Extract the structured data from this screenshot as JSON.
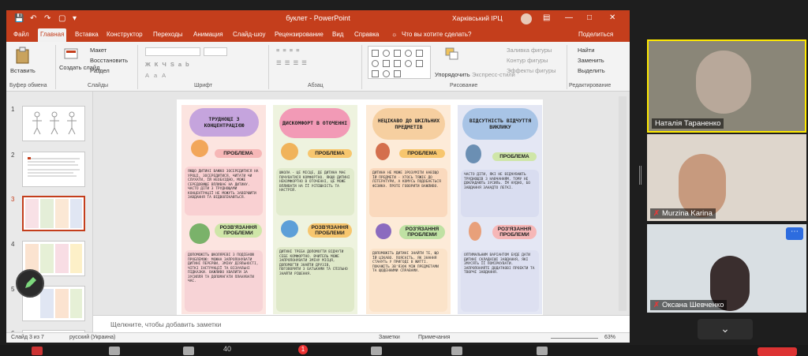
{
  "powerpoint": {
    "document_title": "буклет - PowerPoint",
    "org_label": "Харківський ІРЦ",
    "tabs": [
      "Файл",
      "Главная",
      "Вставка",
      "Конструктор",
      "Переходы",
      "Анимация",
      "Слайд-шоу",
      "Рецензирование",
      "Вид",
      "Справка"
    ],
    "active_tab": "Главная",
    "tell_me": "Что вы хотите сделать?",
    "share": "Поделиться",
    "ribbon": {
      "paste": "Вставить",
      "clipboard": "Буфер обмена",
      "layout": "Макет",
      "restore": "Восстановить",
      "section": "Раздел",
      "new_slide": "Создать слайд",
      "slides": "Слайды",
      "font": "Шрифт",
      "paragraph": "Абзац",
      "arrange": "Упорядочить",
      "quick_styles": "Экспресс-стили",
      "shape_fill": "Заливка фигуры",
      "shape_outline": "Контур фигуры",
      "shape_effects": "Эффекты фигуры",
      "drawing": "Рисование",
      "find": "Найти",
      "replace": "Заменить",
      "select": "Выделить",
      "editing": "Редактирование"
    },
    "slide_numbers": [
      "1",
      "2",
      "3",
      "4",
      "5",
      "6"
    ],
    "notes_placeholder": "Щелкните, чтобы добавить заметки",
    "status": {
      "slide": "Слайд 3 из 7",
      "language": "русский (Украина)",
      "notes": "Заметки",
      "comments": "Примечания",
      "zoom": "63%"
    },
    "slide": {
      "panels": [
        {
          "title": "ТРУДНОЩІ З КОНЦЕНТРАЦІЄЮ",
          "problem": "ПРОБЛЕМА",
          "problem_text": "ЯКЩО ДИТИНІ ВАЖКО ЗОСЕРЕДИТИСЯ НА УРОЦІ, ЗОСЕРЕДИТИСЯ, ЧИТАТИ ЧИ СЛУХАТИ, ЇЙ НЕОБХІДНО, МОЖЕ СЕРЕДОВИЩЕ ВПЛИВАЄ НА ДИТИНУ. ЧАСТО ДІТИ З ТРУДНОЩАМИ КОНЦЕНТРАЦІЇ НЕ МОЖУТЬ ЗАВЕРШИТИ ЗАВДАННЯ ТА ВІДВОЛІКАЮТЬСЯ.",
          "solution": "РОЗВ'ЯЗАННЯ ПРОБЛЕМИ",
          "solution_text": "ДОПОМОЖІТЬ ШКОЛЯРЕВІ З ПОДІБНОЮ ПРОБЛЕМОЮ: МОЖНА ЗАПРОПОНУВАТИ ДИТИНІ ПЕРЕРВИ, ЗМІНУ ДІЯЛЬНОСТІ, ЧІТКІ ІНСТРУКЦІЇ ТА ВІЗУАЛЬНІ ПІДКАЗКИ. ВАЖЛИВО ХВАЛИТИ ЗА ЗУСИЛЛЯ ТА ДОПОМАГАТИ ПЛАНУВАТИ ЧАС."
        },
        {
          "title": "ДИСКОМФОРТ В ОТОЧЕННІ",
          "problem": "ПРОБЛЕМА",
          "problem_text": "ШКОЛА - ЦЕ МІСЦЕ, ДЕ ДИТИНА МАЄ ПОЧУВАТИСЯ КОМФОРТНО. ЯКЩО ДИТИНІ НЕКОМФОРТНО В ОТОЧЕННІ, ЦЕ МОЖЕ ВПЛИВАТИ НА ЇЇ УСПІШНІСТЬ ТА НАСТРІЙ.",
          "solution": "РОЗВ'ЯЗАННЯ ПРОБЛЕМИ",
          "solution_text": "ДИТИНІ ТРЕБА ДОПОМОГТИ ВІДЧУТИ СЕБЕ КОМФОРТНО. ВЧИТЕЛЬ МОЖЕ ЗАПРОПОНУВАТИ ЗМІНУ МІСЦЯ, ДОПОМОГТИ ЗНАЙТИ ДРУЗІВ, ПОГОВОРИТИ З БАТЬКАМИ ТА СПІЛЬНО ЗНАЙТИ РІШЕННЯ."
        },
        {
          "title": "НЕЦІКАВО ДО ШКІЛЬНИХ ПРЕДМЕТІВ",
          "problem": "ПРОБЛЕМА",
          "problem_text": "ДИТИНА НЕ МОЖЕ ЗРОЗУМІТИ НАВІЩО ЇЙ ПРЕДМЕТИ - ХТОСЬ ТЯЖІЄ ДО ЛІТЕРАТУРИ, А КОМУСЬ ПОДОБАЄТЬСЯ ФІЗИКА. ПРОТЕ ГОВОРИТИ ВАЖЛИВО.",
          "solution": "РОЗ'ЯЗАННЯ ПРОБЛЕМИ",
          "solution_text": "ДОПОМОЖІТЬ ДИТИНІ ЗНАЙТИ ТЕ, ЩО ЇЙ ЦІКАВО. ПОЯСНІТЬ, ЯК ЗНАННЯ СТАНУТЬ У ПРИГОДІ В ЖИТТІ. ПОКАЖІТЬ ЗВ'ЯЗОК МІЖ ПРЕДМЕТАМИ ТА ЩОДЕННИМИ СПРАВАМИ."
        },
        {
          "title": "ВІДСУТНІСТЬ ВІДЧУТТЯ ВИКЛИКУ",
          "problem": "ПРОБЛЕМА",
          "problem_text": "ЧАСТО ДІТИ, ЯКІ НЕ ВІДЧУВАЮТЬ ТРУДНОЩІВ З НАВЧАННЯМ, ТОМУ НЕ ДОКЛАДАЮТЬ ЗУСИЛЬ. ЇМ НУДНО, БО ЗАВДАННЯ ЗАНАДТО ЛЕГКІ.",
          "solution": "РОЗ'ЯЗАННЯ ПРОБЛЕМИ",
          "solution_text": "ОПТИМАЛЬНИМ ВАРІАНТОМ БУДЕ ДАТИ ДИТИНІ СКЛАДНІШІ ЗАВДАННЯ, ЯКІ ЗМУСЯТЬ ЇЇ ПОМІРКУВАТИ. ЗАПРОПОНУЙТЕ ДОДАТКОВІ ПРОЕКТИ ТА ТВОРЧІ ЗАВДАННЯ."
        }
      ]
    }
  },
  "participants": [
    {
      "name": "Наталія Тараненко",
      "muted": false,
      "active": true
    },
    {
      "name": "Murzina Karina",
      "muted": true,
      "active": false
    },
    {
      "name": "Оксана Шевченко",
      "muted": true,
      "active": false
    }
  ],
  "zoom_controls": {
    "participants_count": "40",
    "chat_badge": "1"
  },
  "colors": {
    "accent": "#c43e1c",
    "active_speaker": "#ffea00"
  }
}
